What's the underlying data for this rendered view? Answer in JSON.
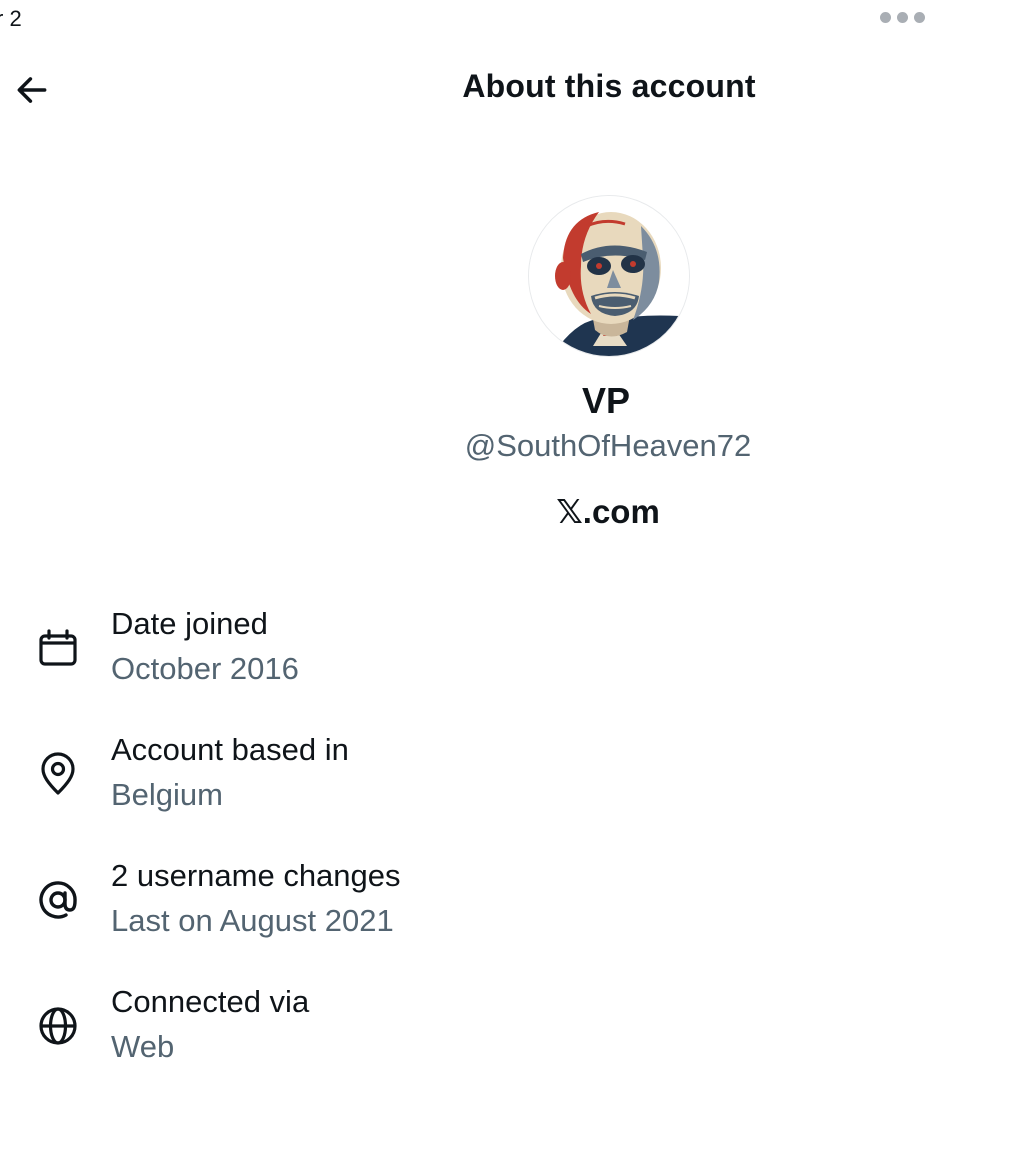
{
  "status_bar": {
    "fragment": "r 2"
  },
  "header": {
    "title": "About this account",
    "back_icon": "arrow-left-icon",
    "more_icon": "more-horizontal-icon"
  },
  "profile": {
    "display_name": "VP",
    "handle": "@SouthOfHeaven72",
    "platform_label": "𝕏.com",
    "avatar_alt": "profile avatar"
  },
  "details": [
    {
      "icon": "calendar-icon",
      "label": "Date joined",
      "value": "October 2016"
    },
    {
      "icon": "location-pin-icon",
      "label": "Account based in",
      "value": "Belgium"
    },
    {
      "icon": "at-sign-icon",
      "label": "2 username changes",
      "value": "Last on August 2021"
    },
    {
      "icon": "globe-icon",
      "label": "Connected via",
      "value": "Web"
    }
  ],
  "colors": {
    "primary_text": "#0f1419",
    "secondary_text": "#536471",
    "background": "#ffffff"
  }
}
